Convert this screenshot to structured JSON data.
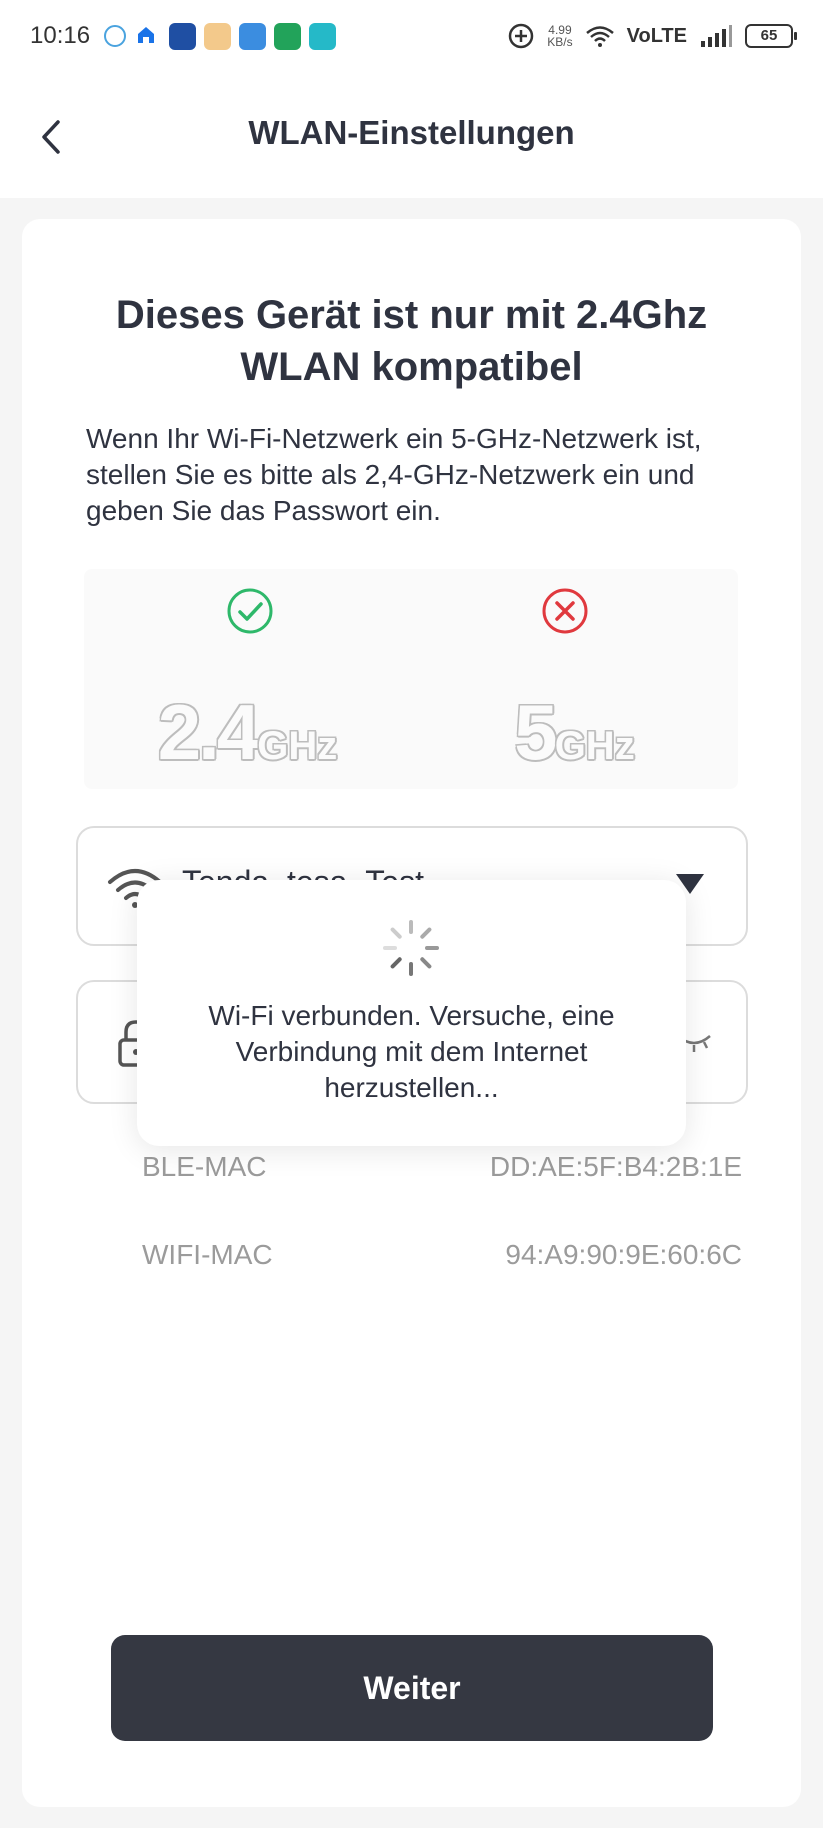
{
  "status_bar": {
    "time": "10:16",
    "speed_value": "4.99",
    "speed_unit": "KB/s",
    "network": "VoLTE",
    "battery": "65"
  },
  "header": {
    "title": "WLAN-Einstellungen",
    "back_icon": "chevron-left-icon"
  },
  "content": {
    "title": "Dieses Gerät ist nur mit 2.4Ghz WLAN kompatibel",
    "description": "Wenn Ihr Wi-Fi-Netzwerk ein 5-GHz-Netzwerk ist, stellen Sie es bitte als 2,4-GHz-Netzwerk ein und geben Sie das Passwort ein.",
    "bands": [
      {
        "num": "2.4",
        "unit": "GHz",
        "supported": true,
        "icon": "check-circle-icon",
        "color": "#2eb86a"
      },
      {
        "num": "5",
        "unit": "GHz",
        "supported": false,
        "icon": "x-circle-icon",
        "color": "#e0393e"
      }
    ]
  },
  "form": {
    "ssid_value": "Tenda_tesa_Test",
    "mac_rows": [
      {
        "label": "BLE-MAC",
        "value": "DD:AE:5F:B4:2B:1E"
      },
      {
        "label": "WIFI-MAC",
        "value": "94:A9:90:9E:60:6C"
      }
    ]
  },
  "button": {
    "label": "Weiter"
  },
  "toast": {
    "message": "Wi-Fi verbunden. Versuche, eine Verbindung mit dem Internet herzustellen..."
  },
  "colors": {
    "primary_button": "#353842",
    "text": "#2f3340",
    "muted": "#9b9b9b"
  }
}
